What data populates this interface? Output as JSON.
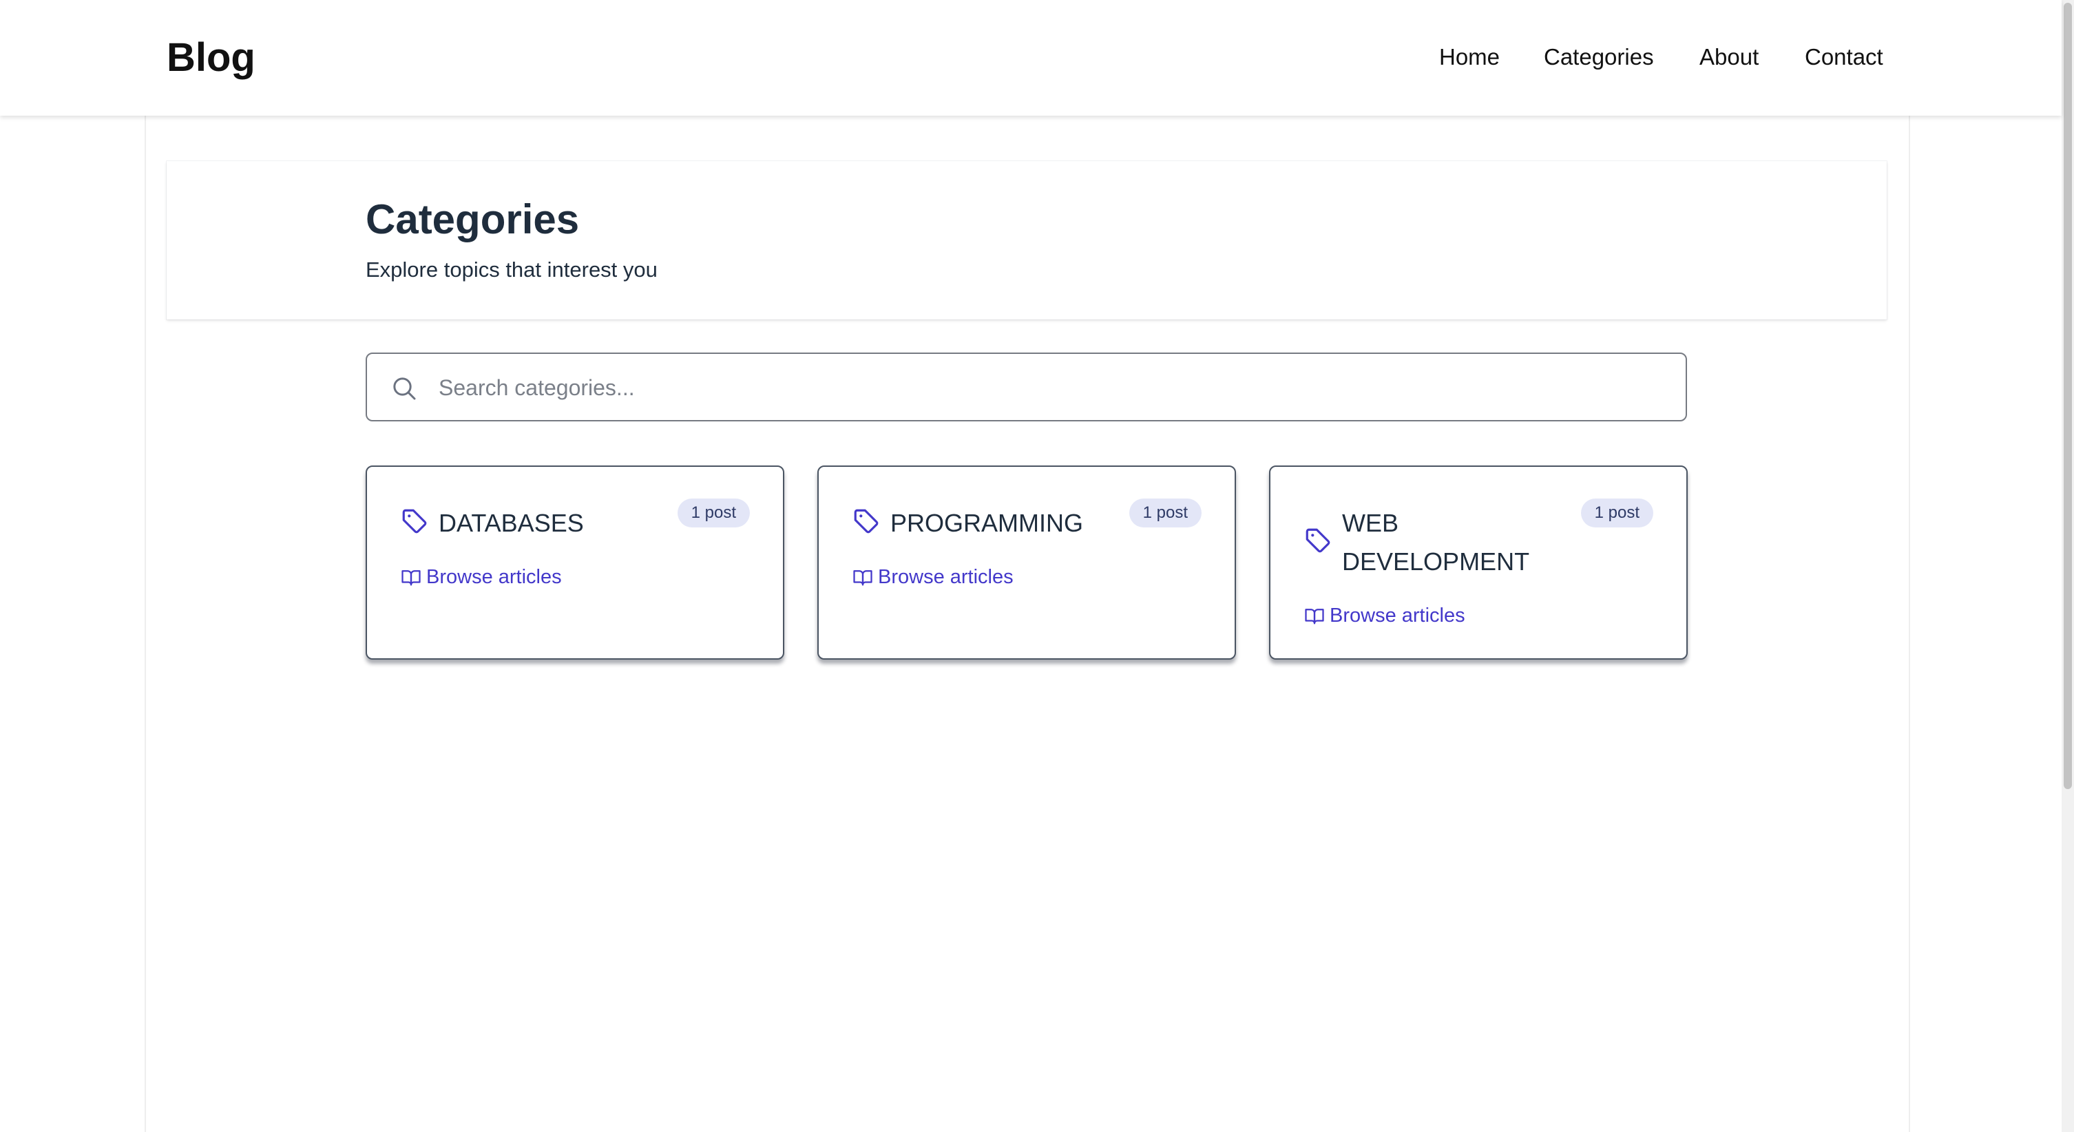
{
  "header": {
    "logo": "Blog",
    "nav": [
      "Home",
      "Categories",
      "About",
      "Contact"
    ]
  },
  "hero": {
    "title": "Categories",
    "subtitle": "Explore topics that interest you"
  },
  "search": {
    "placeholder": "Search categories...",
    "value": ""
  },
  "categories": [
    {
      "name": "DATABASES",
      "count": "1 post",
      "link": "Browse articles"
    },
    {
      "name": "PROGRAMMING",
      "count": "1 post",
      "link": "Browse articles"
    },
    {
      "name": "WEB DEVELOPMENT",
      "count": "1 post",
      "link": "Browse articles"
    }
  ],
  "icons": {
    "search": "search-icon",
    "category": "tag-icon",
    "browse": "book-open-icon"
  },
  "colors": {
    "accent": "#4338ca",
    "heading": "#1f2d3d",
    "badge_bg": "#e3e6f7",
    "badge_text": "#2e3a66"
  }
}
